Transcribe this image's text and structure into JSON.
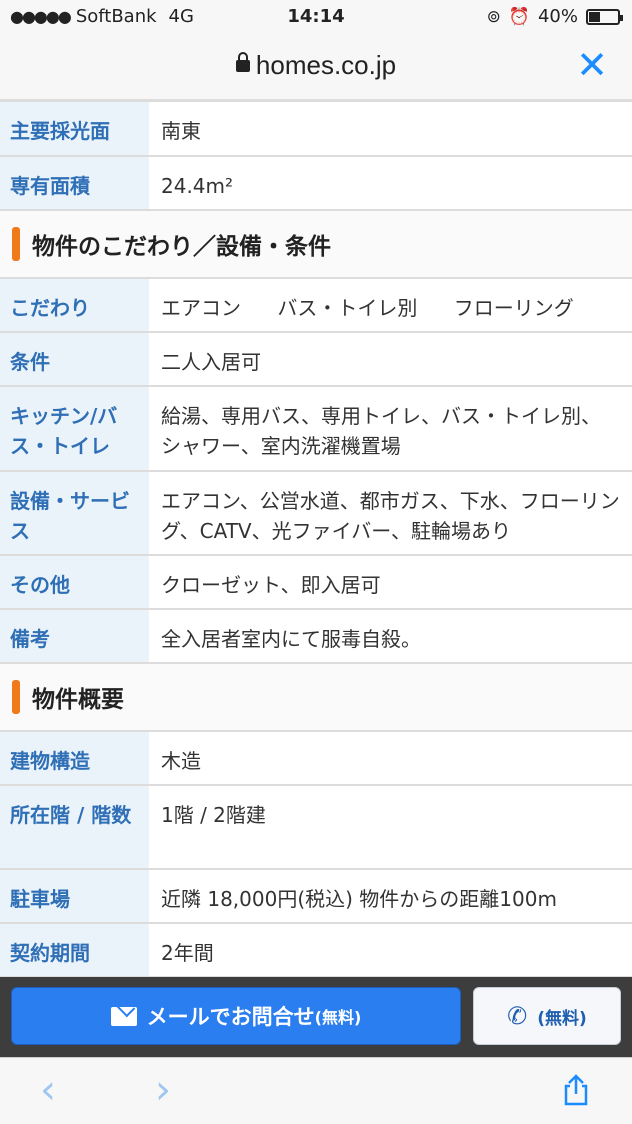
{
  "status_bar": {
    "signal": "●●●●●",
    "carrier": "SoftBank",
    "network": "4G",
    "time": "14:14",
    "battery_percent": "40%",
    "battery_level": 0.4
  },
  "url_bar": {
    "domain": "homes.co.jp"
  },
  "top_rows": [
    {
      "label": "主要採光面",
      "value": "南東"
    },
    {
      "label": "専有面積",
      "value": "24.4m²"
    }
  ],
  "section_features": {
    "title": "物件のこだわり／設備・条件",
    "kodawari_label": "こだわり",
    "kodawari_tags": [
      "エアコン",
      "バス・トイレ別",
      "フローリング"
    ],
    "rows": [
      {
        "label": "条件",
        "value": "二人入居可"
      },
      {
        "label": "キッチン/バス・トイレ",
        "value": "給湯、専用バス、専用トイレ、バス・トイレ別、シャワー、室内洗濯機置場"
      },
      {
        "label": "設備・サービス",
        "value": "エアコン、公営水道、都市ガス、下水、フローリング、CATV、光ファイバー、駐輪場あり"
      },
      {
        "label": "その他",
        "value": "クローゼット、即入居可"
      },
      {
        "label": "備考",
        "value": "全入居者室内にて服毒自殺。"
      }
    ]
  },
  "section_overview": {
    "title": "物件概要",
    "rows": [
      {
        "label": "建物構造",
        "value": "木造"
      },
      {
        "label": "所在階 / 階数",
        "value": "1階 / 2階建"
      },
      {
        "label": "駐車場",
        "value": "近隣 18,000円(税込) 物件からの距離100m"
      },
      {
        "label": "契約期間",
        "value": "2年間"
      }
    ]
  },
  "cta": {
    "mail_label": "メールでお問合せ",
    "mail_suffix": "(無料)",
    "tel_label": "(無料)"
  },
  "colors": {
    "accent": "#f07a1a",
    "label_text": "#2f6fb6",
    "primary_button": "#2a7ef0"
  }
}
